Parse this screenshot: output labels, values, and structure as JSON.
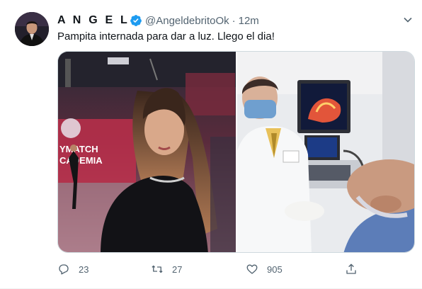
{
  "tweet": {
    "display_name": "A N G E L",
    "handle": "@AngeldebritoOk",
    "separator": "·",
    "time": "12m",
    "text": "Pampita internada para dar a luz. Llego el dia!",
    "verified": true
  },
  "media": {
    "left_banner_lines": [
      "YMATCH",
      "CADEMIA"
    ]
  },
  "actions": {
    "replies": "23",
    "retweets": "27",
    "likes": "905"
  },
  "icons": {
    "more": "more-caret-icon",
    "verified": "verified-badge-icon",
    "reply": "reply-icon",
    "retweet": "retweet-icon",
    "like": "like-icon",
    "share": "share-icon"
  },
  "colors": {
    "verified_blue": "#1d9bf0",
    "text_primary": "#0f1419",
    "text_secondary": "#536471"
  }
}
